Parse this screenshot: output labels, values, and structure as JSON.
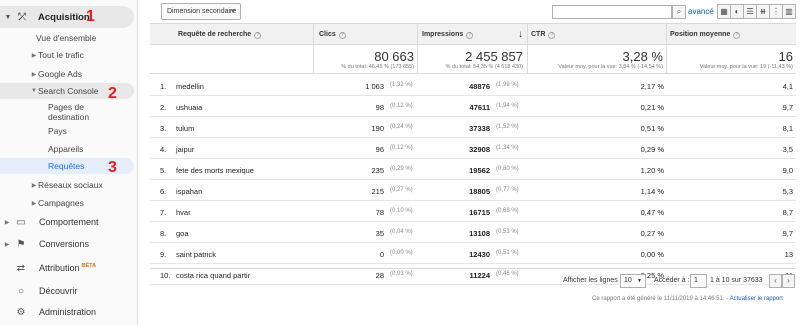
{
  "sidebar": {
    "acquisition": "Acquisition",
    "acq_items": {
      "overview": "Vue d'ensemble",
      "all_traffic": "Tout le trafic",
      "google_ads": "Google Ads",
      "search_console": "Search Console",
      "landing_pages": "Pages de destination",
      "countries": "Pays",
      "devices": "Appareils",
      "queries": "Requêtes",
      "social": "Réseaux sociaux",
      "campaigns": "Campagnes"
    },
    "behavior": "Comportement",
    "conversions": "Conversions",
    "attribution": "Attribution",
    "attribution_badge": "BÊTA",
    "discover": "Découvrir",
    "admin": "Administration",
    "markers": [
      "1",
      "2",
      "3"
    ]
  },
  "toolbar": {
    "secondary_dimension": "Dimension secondaire",
    "search_placeholder": "",
    "advanced": "avancé"
  },
  "table": {
    "headers": {
      "query": "Requête de recherche",
      "clicks": "Clics",
      "impressions": "Impressions",
      "ctr": "CTR",
      "position": "Position moyenne"
    },
    "totals": {
      "clicks": "80 663",
      "clicks_sub": "% du total: 46,45 % (173 655)",
      "impressions": "2 455 857",
      "impressions_sub": "% du total: 54,35 % (4 518 430)",
      "ctr": "3,28 %",
      "ctr_sub": "Valeur moy. pour la vue: 3,84 % (-14,54 %)",
      "position": "16",
      "position_sub": "Valeur moy. pour la vue: 19 (-11,43 %)"
    },
    "rows": [
      {
        "idx": "1.",
        "query": "medellin",
        "clicks": "1 063",
        "clicks_pct": "(1,32 %)",
        "impr": "48876",
        "impr_pct": "(1,99 %)",
        "ctr": "2,17 %",
        "pos": "4,1"
      },
      {
        "idx": "2.",
        "query": "ushuaia",
        "clicks": "98",
        "clicks_pct": "(0,12 %)",
        "impr": "47611",
        "impr_pct": "(1,94 %)",
        "ctr": "0,21 %",
        "pos": "9,7"
      },
      {
        "idx": "3.",
        "query": "tulum",
        "clicks": "190",
        "clicks_pct": "(0,24 %)",
        "impr": "37338",
        "impr_pct": "(1,52 %)",
        "ctr": "0,51 %",
        "pos": "8,1"
      },
      {
        "idx": "4.",
        "query": "jaipur",
        "clicks": "96",
        "clicks_pct": "(0,12 %)",
        "impr": "32908",
        "impr_pct": "(1,34 %)",
        "ctr": "0,29 %",
        "pos": "3,5"
      },
      {
        "idx": "5.",
        "query": "fete des morts mexique",
        "clicks": "235",
        "clicks_pct": "(0,29 %)",
        "impr": "19562",
        "impr_pct": "(0,80 %)",
        "ctr": "1,20 %",
        "pos": "9,0"
      },
      {
        "idx": "6.",
        "query": "ispahan",
        "clicks": "215",
        "clicks_pct": "(0,27 %)",
        "impr": "18805",
        "impr_pct": "(0,77 %)",
        "ctr": "1,14 %",
        "pos": "5,3"
      },
      {
        "idx": "7.",
        "query": "hvar",
        "clicks": "78",
        "clicks_pct": "(0,10 %)",
        "impr": "16715",
        "impr_pct": "(0,68 %)",
        "ctr": "0,47 %",
        "pos": "8,7"
      },
      {
        "idx": "8.",
        "query": "goa",
        "clicks": "35",
        "clicks_pct": "(0,04 %)",
        "impr": "13108",
        "impr_pct": "(0,53 %)",
        "ctr": "0,27 %",
        "pos": "9,7"
      },
      {
        "idx": "9.",
        "query": "saint patrick",
        "clicks": "0",
        "clicks_pct": "(0,00 %)",
        "impr": "12430",
        "impr_pct": "(0,51 %)",
        "ctr": "0,00 %",
        "pos": "13"
      },
      {
        "idx": "10.",
        "query": "costa rica quand partir",
        "clicks": "28",
        "clicks_pct": "(0,03 %)",
        "impr": "11224",
        "impr_pct": "(0,46 %)",
        "ctr": "0,25 %",
        "pos": "11"
      }
    ]
  },
  "pager": {
    "show_rows_label": "Afficher les lignes :",
    "rows_value": "10",
    "goto_label": "Accéder à :",
    "goto_value": "1",
    "range": "1 à 10 sur 37633"
  },
  "footer": {
    "generated": "Ce rapport a été généré le 11/11/2019 à 14:46:51. -",
    "refresh": "Actualiser le rapport"
  }
}
